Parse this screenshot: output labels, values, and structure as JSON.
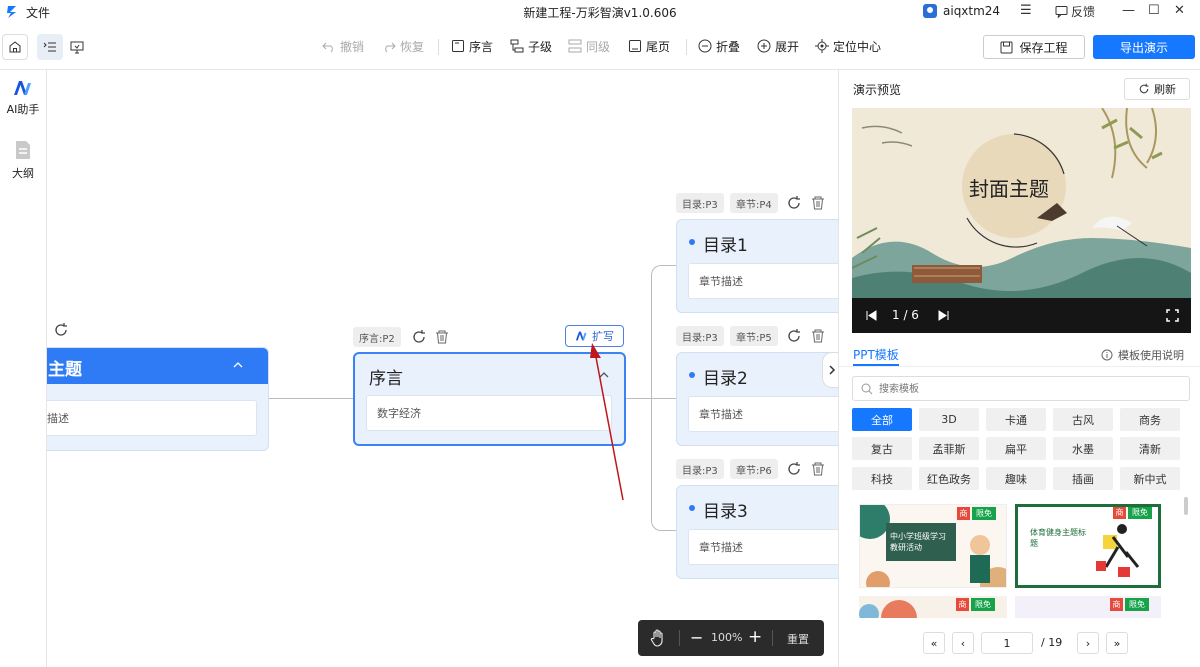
{
  "app": {
    "file_menu": "文件",
    "title": "新建工程-万彩智演v1.0.606",
    "username": "aiqxtm24",
    "feedback": "反馈"
  },
  "toolbar": {
    "undo": "撤销",
    "redo": "恢复",
    "preface": "序言",
    "child": "子级",
    "sibling": "同级",
    "endpage": "尾页",
    "collapse": "折叠",
    "expand": "展开",
    "locate": "定位中心",
    "save": "保存工程",
    "export": "导出演示"
  },
  "sidebar": {
    "items": [
      {
        "label": "AI助手"
      },
      {
        "label": "大纲"
      }
    ]
  },
  "canvas": {
    "cover": {
      "title": "主题",
      "desc": "描述"
    },
    "preface": {
      "tag": "序言:P2",
      "title": "序言",
      "desc": "数字经济",
      "ai_button": "扩写"
    },
    "chapters": [
      {
        "tag_dir": "目录:P3",
        "tag_sec": "章节:P4",
        "title": "目录1",
        "desc": "章节描述"
      },
      {
        "tag_dir": "目录:P3",
        "tag_sec": "章节:P5",
        "title": "目录2",
        "desc": "章节描述"
      },
      {
        "tag_dir": "目录:P3",
        "tag_sec": "章节:P6",
        "title": "目录3",
        "desc": "章节描述"
      }
    ],
    "zoom": {
      "value": "100%",
      "reset": "重置"
    }
  },
  "preview": {
    "header": "演示预览",
    "refresh": "刷新",
    "slide_title": "封面主题",
    "page_indicator": "1 / 6"
  },
  "templates": {
    "tab": "PPT模板",
    "help": "模板使用说明",
    "search_placeholder": "搜索模板",
    "categories": [
      "全部",
      "3D",
      "卡通",
      "古风",
      "商务",
      "复古",
      "孟菲斯",
      "扁平",
      "水墨",
      "清新",
      "科技",
      "红色政务",
      "趣味",
      "插画",
      "新中式"
    ],
    "cards": [
      {
        "badge_shop": "商",
        "badge_free": "限免",
        "text": "中小学班级学习教研活动"
      },
      {
        "badge_shop": "商",
        "badge_free": "限免",
        "text": "体育健身主题标题"
      },
      {
        "badge_shop": "商",
        "badge_free": "限免",
        "text": ""
      },
      {
        "badge_shop": "商",
        "badge_free": "限免",
        "text": ""
      }
    ],
    "pagination": {
      "current": "1",
      "total": "/ 19"
    }
  },
  "colors": {
    "accent": "#1677ff",
    "node_bg": "#e9f1fc",
    "cover_header": "#2f7bf5",
    "arrow": "#c0151a"
  }
}
